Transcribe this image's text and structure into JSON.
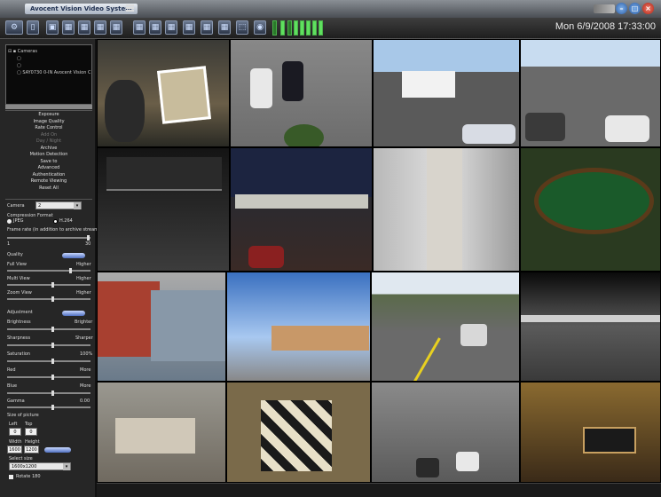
{
  "app": {
    "title": "Avocent Vision Video System",
    "datetime": "Mon 6/9/2008 17:33:00"
  },
  "window_buttons": {
    "minimize": "–",
    "maximize": "□",
    "close": "×"
  },
  "toolbar": {
    "icons": [
      "config-icon",
      "layout-icon",
      "single-view-icon",
      "quad-view-icon",
      "grid6-icon",
      "grid9-icon",
      "grid12-icon",
      "grid16-icon",
      "sequence-icon",
      "snapshot-icon",
      "export-icon",
      "record-icon",
      "camera-icon"
    ],
    "meter_levels": [
      1,
      1,
      1,
      1,
      1,
      1,
      1,
      1,
      1,
      1,
      1
    ]
  },
  "tree": {
    "root": "Cameras",
    "node": "SAY0730 0-IN Avocent Vision C"
  },
  "menu": [
    {
      "label": "Exposure",
      "enabled": true
    },
    {
      "label": "Image Quality",
      "enabled": true
    },
    {
      "label": "Rate Control",
      "enabled": true
    },
    {
      "label": "Add On",
      "enabled": false
    },
    {
      "label": "Day / Night",
      "enabled": false
    },
    {
      "label": "Archive",
      "enabled": true
    },
    {
      "label": "Motion Detection",
      "enabled": true
    },
    {
      "label": "Save to",
      "enabled": true
    },
    {
      "label": "Advanced",
      "enabled": true
    },
    {
      "label": "Authentication",
      "enabled": true
    },
    {
      "label": "Remote Viewing",
      "enabled": true
    },
    {
      "label": "Reset All",
      "enabled": true
    }
  ],
  "settings": {
    "camera_label": "Camera",
    "camera_value": "2",
    "compression_label": "Compression Format",
    "format_a": "JPEG",
    "format_b": "H.264",
    "frame_rate_label": "Frame rate (in addition to archive stream)",
    "frame_min": "1",
    "frame_max": "30",
    "quality_label": "Quality",
    "full_view": "Full View",
    "multi_view": "Multi View",
    "zoom_view": "Zoom View",
    "higher": "Higher",
    "adjustment_label": "Adjustment",
    "brightness": "Brightness",
    "brighter": "Brighter",
    "sharpness": "Sharpness",
    "sharper": "Sharper",
    "saturation": "Saturation",
    "saturation_val": "100%",
    "red": "Red",
    "more": "More",
    "blue": "Blue",
    "gamma": "Gamma",
    "gamma_val": "0.00",
    "size_label": "Size of picture",
    "left": "Left",
    "top": "Top",
    "left_val": "0",
    "top_val": "0",
    "width": "Width",
    "height": "Height",
    "width_val": "1600",
    "height_val": "1200",
    "select_size": "Select size",
    "size_value": "1600x1200",
    "rotate": "Rotate 180"
  }
}
